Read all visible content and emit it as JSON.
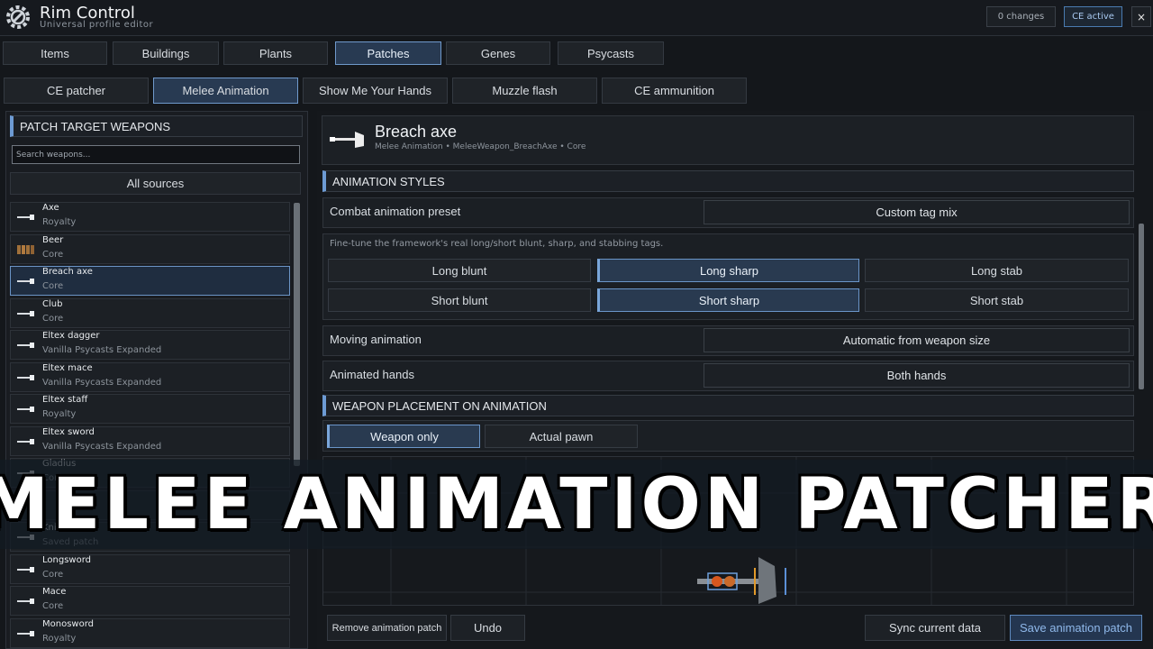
{
  "app": {
    "title": "Rim Control",
    "subtitle": "Universal profile editor"
  },
  "status": {
    "changes": "0 changes",
    "ce": "CE active",
    "close": "×"
  },
  "tabs": [
    "Items",
    "Buildings",
    "Plants",
    "Patches",
    "Genes",
    "Psycasts"
  ],
  "active_tab": "Patches",
  "subtabs": [
    "CE patcher",
    "Melee Animation",
    "Show Me Your Hands",
    "Muzzle flash",
    "CE ammunition"
  ],
  "active_subtab": "Melee Animation",
  "left": {
    "section": "PATCH TARGET WEAPONS",
    "search_placeholder": "Search weapons...",
    "source_filter": "All sources",
    "weapons": [
      {
        "name": "Axe",
        "source": "Royalty",
        "icon": "axe-icon"
      },
      {
        "name": "Beer",
        "source": "Core",
        "icon": "beer-icon"
      },
      {
        "name": "Breach axe",
        "source": "Core",
        "icon": "breach-axe-icon",
        "selected": true
      },
      {
        "name": "Club",
        "source": "Core",
        "icon": "club-icon"
      },
      {
        "name": "Eltex dagger",
        "source": "Vanilla Psycasts Expanded",
        "icon": "dagger-icon"
      },
      {
        "name": "Eltex mace",
        "source": "Vanilla Psycasts Expanded",
        "icon": "mace-icon"
      },
      {
        "name": "Eltex staff",
        "source": "Royalty",
        "icon": "staff-icon"
      },
      {
        "name": "Eltex sword",
        "source": "Vanilla Psycasts Expanded",
        "icon": "sword-icon"
      },
      {
        "name": "Gladius",
        "source": "Core",
        "icon": "gladius-icon"
      },
      {
        "name": "",
        "source": "",
        "icon": "weapon-icon"
      },
      {
        "name": "Knife",
        "source": "Saved patch",
        "icon": "knife-icon"
      },
      {
        "name": "Longsword",
        "source": "Core",
        "icon": "longsword-icon"
      },
      {
        "name": "Mace",
        "source": "Core",
        "icon": "mace-icon"
      },
      {
        "name": "Monosword",
        "source": "Royalty",
        "icon": "monosword-icon"
      }
    ]
  },
  "detail": {
    "title": "Breach axe",
    "subtitle": "Melee Animation  •  MeleeWeapon_BreachAxe  •  Core",
    "anim_section": "ANIMATION STYLES",
    "preset_label": "Combat animation preset",
    "preset_value": "Custom tag mix",
    "hint": "Fine-tune the framework's real long/short blunt, sharp, and stabbing tags.",
    "tags": [
      {
        "label": "Long blunt",
        "on": false
      },
      {
        "label": "Long sharp",
        "on": true
      },
      {
        "label": "Long stab",
        "on": false
      },
      {
        "label": "Short blunt",
        "on": false
      },
      {
        "label": "Short sharp",
        "on": true
      },
      {
        "label": "Short stab",
        "on": false
      }
    ],
    "moving_label": "Moving animation",
    "moving_value": "Automatic from weapon size",
    "hands_label": "Animated hands",
    "hands_value": "Both hands",
    "placement_section": "WEAPON PLACEMENT ON ANIMATION",
    "placement_options": [
      {
        "label": "Weapon only",
        "on": true
      },
      {
        "label": "Actual pawn",
        "on": false
      }
    ]
  },
  "footer": {
    "remove": "Remove animation patch",
    "undo": "Undo",
    "sync": "Sync current data",
    "save": "Save animation patch"
  },
  "banner": {
    "title": "MELEE ANIMATION PATCHER"
  },
  "colors": {
    "accent": "#6d9bd4",
    "selected_bg": "#283a52",
    "banner_text": "#ffffff"
  }
}
